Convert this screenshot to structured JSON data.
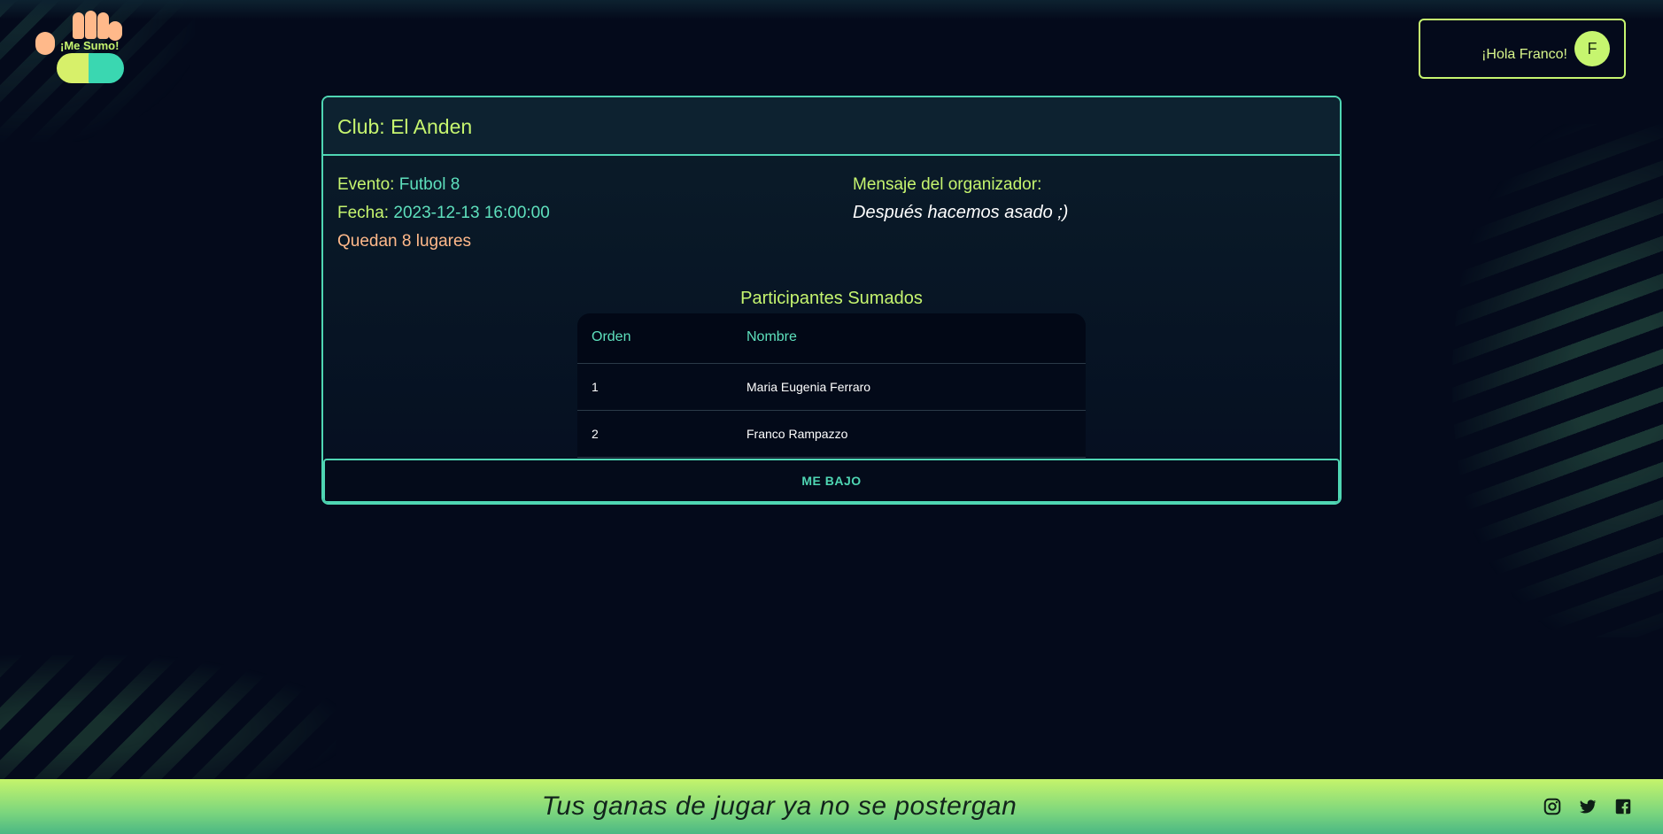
{
  "brand": {
    "logo_text": "¡Me Sumo!",
    "colors": {
      "lime": "#c6f56f",
      "teal": "#4fd6b3",
      "peach": "#ffb98a",
      "bg": "#040a1b"
    }
  },
  "header": {
    "greeting": "¡Hola Franco!",
    "avatar_initial": "F"
  },
  "card": {
    "title": "Club: El Anden",
    "evento_label": "Evento:",
    "evento_value": "Futbol 8",
    "fecha_label": "Fecha:",
    "fecha_value": "2023-12-13 16:00:00",
    "lugares": "Quedan 8 lugares",
    "mensaje_label": "Mensaje del organizador:",
    "mensaje_value": "Después hacemos asado ;)",
    "participants_title": "Participantes Sumados",
    "table": {
      "headers": [
        "Orden",
        "Nombre"
      ],
      "rows": [
        {
          "orden": "1",
          "nombre": "Maria Eugenia Ferraro"
        },
        {
          "orden": "2",
          "nombre": "Franco Rampazzo"
        }
      ]
    },
    "button_label": "ME BAJO"
  },
  "footer": {
    "tagline": "Tus ganas de jugar ya no se postergan",
    "social_icons": [
      "instagram-icon",
      "twitter-icon",
      "facebook-icon"
    ]
  }
}
